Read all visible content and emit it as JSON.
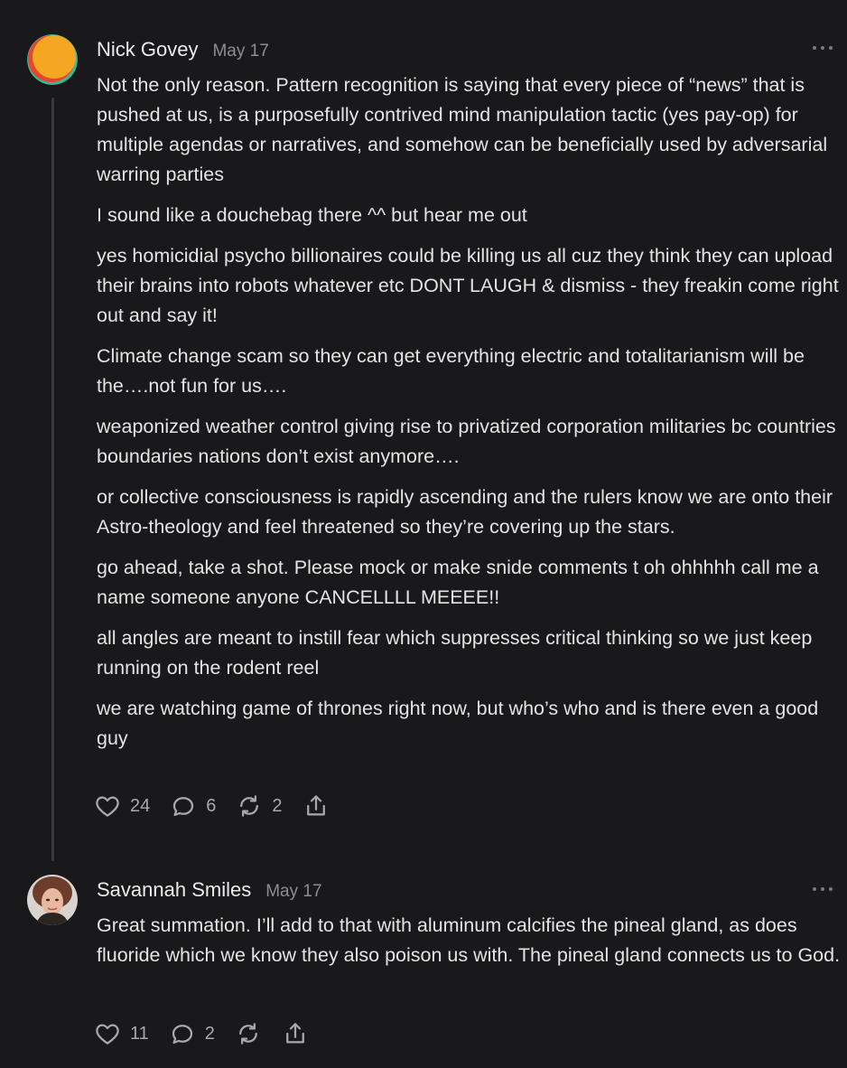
{
  "comments": [
    {
      "author": "Nick Govey",
      "date": "May 17",
      "avatar_colors": [
        "#f5a623",
        "#e8452c",
        "#3bb89a"
      ],
      "paragraphs": [
        "Not the only reason. Pattern recognition is saying that every piece of “news” that is pushed at us, is a purposefully contrived mind manipulation tactic (yes pay-op) for multiple agendas or narratives, and somehow can be beneficially used by adversarial warring parties",
        "I sound like a douchebag there ^^ but hear me out",
        "yes homicidial psycho billionaires could be killing us all cuz they think they can upload their brains into robots whatever etc DONT LAUGH & dismiss - they freakin come right out and say it!",
        "Climate change scam so they can get everything electric and totalitarianism will be the….not fun for us….",
        "weaponized weather control giving rise to privatized corporation militaries bc countries boundaries nations don’t exist anymore….",
        "or collective consciousness is rapidly ascending and the rulers know we are onto their Astro-theology and feel threatened so they’re covering up the stars.",
        "go ahead, take a shot. Please mock or make snide comments t oh ohhhhh call me a name someone anyone CANCELLLL MEEEE!!",
        "all angles are meant to instill fear which suppresses critical thinking so we just keep running on the rodent reel",
        "we are watching game of thrones right now, but who’s who and is there even a good guy"
      ],
      "likes": "24",
      "replies": "6",
      "restacks": "2"
    },
    {
      "author": "Savannah Smiles",
      "date": "May 17",
      "paragraphs": [
        "Great summation. I’ll add to that with aluminum calcifies the pineal gland, as does fluoride which we know they also poison us with. The pineal gland connects us to God."
      ],
      "likes": "11",
      "replies": "2",
      "restacks": ""
    }
  ],
  "icons": {
    "like": "heart-icon",
    "reply": "speech-bubble-icon",
    "restack": "restack-arrows-icon",
    "share": "share-icon",
    "more": "more-dots-icon"
  },
  "colors": {
    "background": "#19191b",
    "text": "#e4e4e4",
    "muted": "#8d8d92",
    "thread_line": "#3a3a3c"
  }
}
